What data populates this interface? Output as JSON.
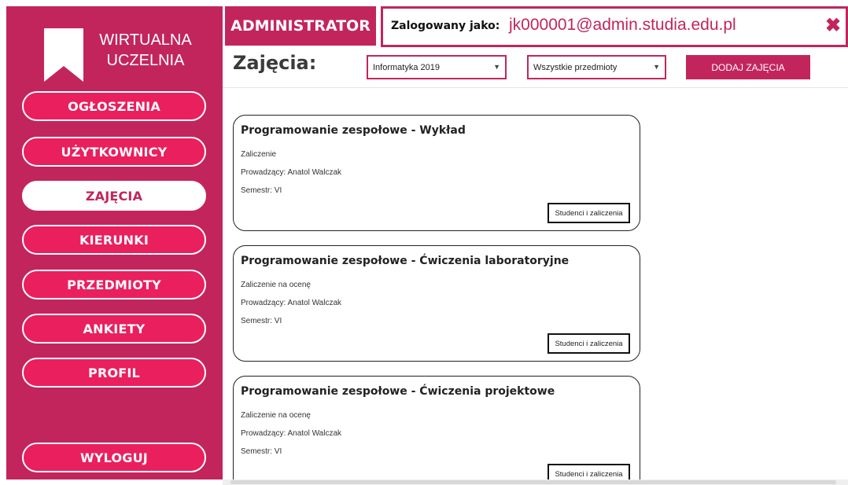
{
  "app": {
    "logo_line1": "WIRTUALNA",
    "logo_line2": "UCZELNIA"
  },
  "sidebar": {
    "items": [
      {
        "label": "OGŁOSZENIA",
        "active": false
      },
      {
        "label": "UŻYTKOWNICY",
        "active": false
      },
      {
        "label": "ZAJĘCIA",
        "active": true
      },
      {
        "label": "KIERUNKI",
        "active": false
      },
      {
        "label": "PRZEDMIOTY",
        "active": false
      },
      {
        "label": "ANKIETY",
        "active": false
      },
      {
        "label": "PROFIL",
        "active": false
      }
    ],
    "logout_label": "WYLOGUJ"
  },
  "header": {
    "role": "ADMINISTRATOR",
    "logged_in_label": "Zalogowany jako:",
    "email": "jk000001@admin.studia.edu.pl",
    "close_icon": "close-icon"
  },
  "toolbar": {
    "title": "Zajęcia:",
    "field_of_study_select": "Informatyka 2019",
    "subject_select": "Wszystkie przedmioty",
    "add_button": "DODAJ ZAJĘCIA"
  },
  "classes": [
    {
      "title": "Programowanie zespołowe - Wykład",
      "assessment": "Zaliczenie",
      "teacher": "Prowadzący: Anatol Walczak",
      "semester": "Semestr: VI",
      "button": "Studenci i zaliczenia"
    },
    {
      "title": "Programowanie zespołowe - Ćwiczenia laboratoryjne",
      "assessment": "Zaliczenie na ocenę",
      "teacher": "Prowadzący: Anatol Walczak",
      "semester": "Semestr: VI",
      "button": "Studenci i zaliczenia"
    },
    {
      "title": "Programowanie zespołowe - Ćwiczenia projektowe",
      "assessment": "Zaliczenie na ocenę",
      "teacher": "Prowadzący: Anatol Walczak",
      "semester": "Semestr: VI",
      "button": "Studenci i zaliczenia"
    }
  ],
  "colors": {
    "brand": "#c2255c",
    "button": "#ea1f5d",
    "white": "#ffffff"
  }
}
